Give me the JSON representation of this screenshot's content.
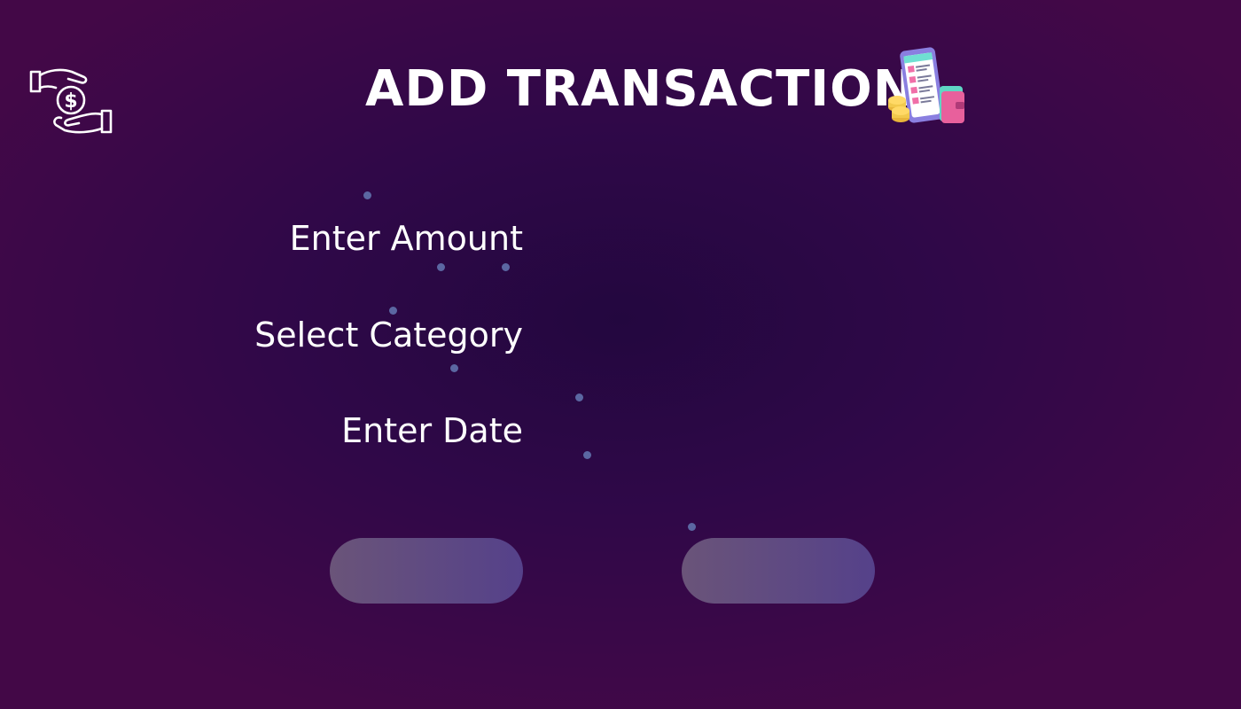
{
  "header": {
    "title": "ADD TRANSACTION",
    "logo_icon": "hands-dollar-icon",
    "title_icon": "phone-receipt-wallet-coins-icon"
  },
  "form": {
    "fields": [
      {
        "label": "Enter Amount"
      },
      {
        "label": "Select Category"
      },
      {
        "label": "Enter Date"
      }
    ]
  },
  "buttons": [
    {
      "label": ""
    },
    {
      "label": ""
    }
  ],
  "colors": {
    "background_center": "#23073f",
    "background_edge": "#430847",
    "text": "#ffffff",
    "dot": "#5b67a2",
    "button_start": "#6a5479",
    "button_end": "#55418a"
  }
}
